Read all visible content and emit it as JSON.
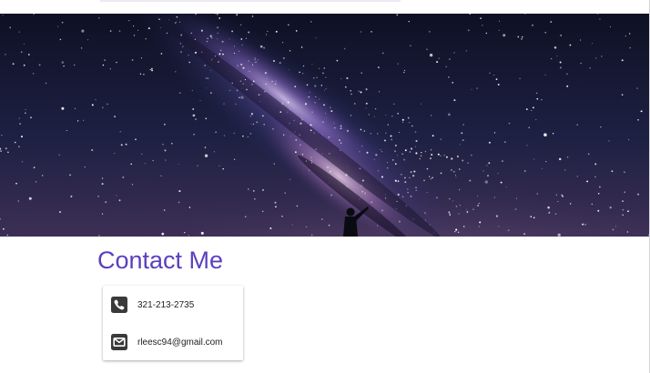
{
  "contact": {
    "title": "Contact Me",
    "phone": "321-213-2735",
    "email": "rleesc94@gmail.com"
  },
  "hero": {
    "icon": "milky-way-night-sky-image"
  },
  "colors": {
    "title": "#5b3fbf",
    "icon": "#3a3a3a",
    "sky": "#121530"
  },
  "icons": {
    "phone": "phone-icon",
    "email": "envelope-icon"
  }
}
